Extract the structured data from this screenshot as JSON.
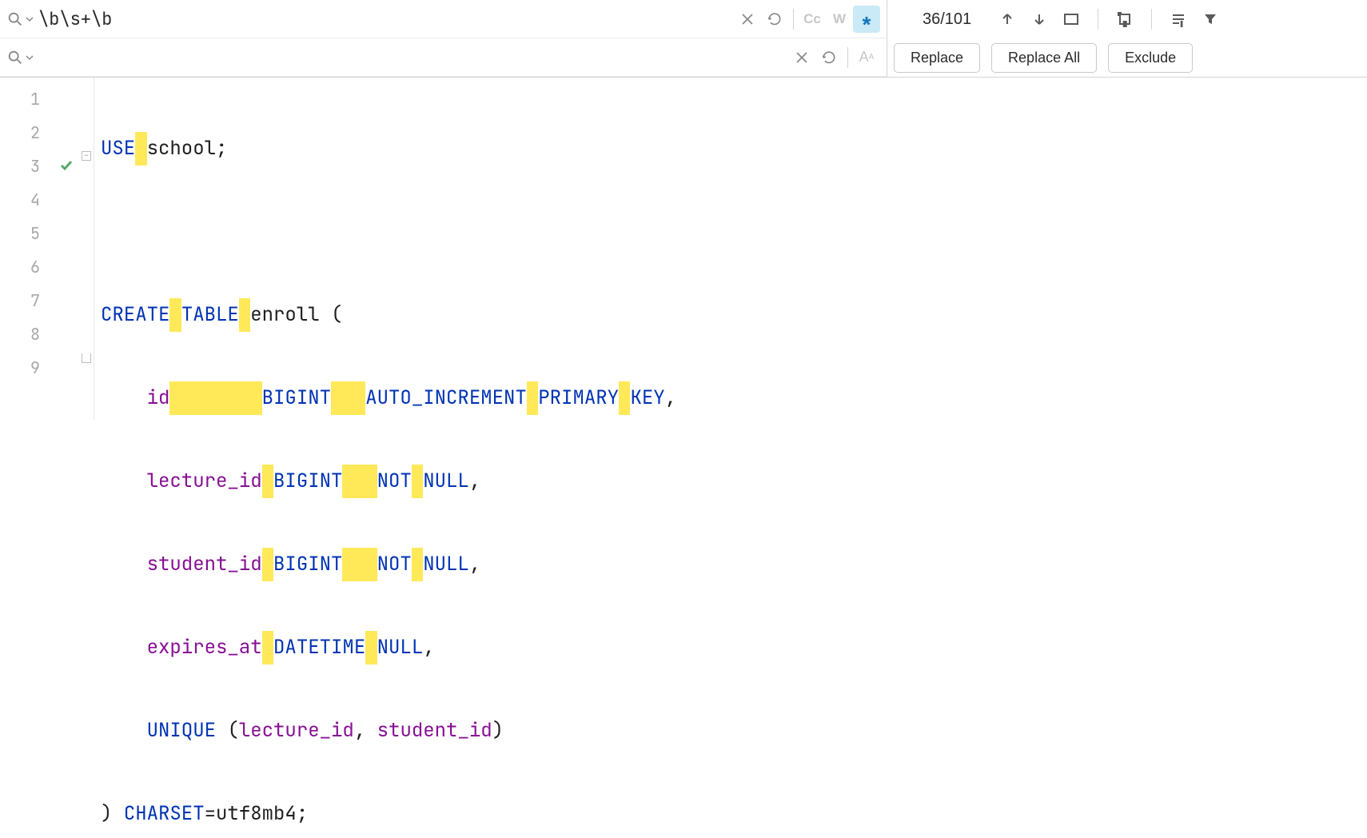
{
  "search": {
    "value": "\\b\\s+\\b"
  },
  "replace": {
    "value": ""
  },
  "options": {
    "cc": "Cc",
    "w": "W",
    "regex": "*"
  },
  "counter": "36/101",
  "buttons": {
    "replace": "Replace",
    "replace_all": "Replace All",
    "exclude": "Exclude"
  },
  "gutter": {
    "lines": [
      "1",
      "2",
      "3",
      "4",
      "5",
      "6",
      "7",
      "8",
      "9"
    ]
  },
  "code": {
    "l1": {
      "kw_use": "USE",
      "sp1": " ",
      "sch": "school",
      "sc": ";"
    },
    "l3": {
      "kw_create": "CREATE",
      "sp1": " ",
      "kw_table": "TABLE",
      "sp2": " ",
      "name": "enroll ("
    },
    "l4": {
      "indent": "    ",
      "id": "id",
      "sp1": "        ",
      "bigint": "BIGINT",
      "sp2": "   ",
      "auto": "AUTO_INCREMENT",
      "sp3": " ",
      "prim": "PRIMARY",
      "sp4": " ",
      "key": "KEY",
      "comma": ","
    },
    "l5": {
      "indent": "    ",
      "col": "lecture_id",
      "sp1": " ",
      "bigint": "BIGINT",
      "sp2": "   ",
      "notkw": "NOT",
      "sp3": " ",
      "nullkw": "NULL",
      "comma": ","
    },
    "l6": {
      "indent": "    ",
      "col": "student_id",
      "sp1": " ",
      "bigint": "BIGINT",
      "sp2": "   ",
      "notkw": "NOT",
      "sp3": " ",
      "nullkw": "NULL",
      "comma": ","
    },
    "l7": {
      "indent": "    ",
      "col": "expires_at",
      "sp1": " ",
      "dt": "DATETIME",
      "sp2": " ",
      "nullkw": "NULL",
      "comma": ","
    },
    "l8": {
      "indent": "    ",
      "uniq": "UNIQUE",
      "paren": " (",
      "c1": "lecture_id",
      "cm": ", ",
      "c2": "student_id",
      "close": ")"
    },
    "l9": {
      "close": ") ",
      "charset": "CHARSET",
      "eq": "=utf8mb4;"
    }
  }
}
